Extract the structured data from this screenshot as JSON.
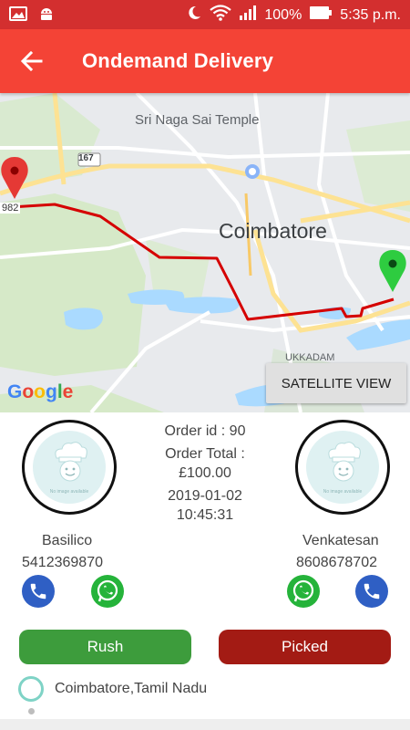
{
  "status_bar": {
    "battery": "100%",
    "time": "5:35 p.m."
  },
  "app_bar": {
    "title": "Ondemand Delivery"
  },
  "map": {
    "labels": {
      "temple": "Sri Naga Sai Temple",
      "city": "Coimbatore",
      "area": "UKKADAM",
      "route_shield": "167",
      "edge_fragment": "982"
    },
    "google_logo": "Google",
    "satellite_button": "SATELLITE VIEW",
    "colors": {
      "route": "#d50000",
      "start_marker": "#e53935",
      "end_marker": "#2ecc40"
    }
  },
  "order": {
    "id_text": "Order id : 90",
    "total_label": "Order Total :",
    "total_value": "£100.00",
    "date": "2019-01-02",
    "time": "10:45:31"
  },
  "restaurant": {
    "name": "Basilico",
    "phone": "5412369870",
    "avatar_caption": "No image available"
  },
  "customer": {
    "name": "Venkatesan",
    "phone": "8608678702",
    "avatar_caption": "No image available"
  },
  "actions": {
    "rush": "Rush",
    "picked": "Picked"
  },
  "location": {
    "text": "Coimbatore,Tamil Nadu"
  }
}
